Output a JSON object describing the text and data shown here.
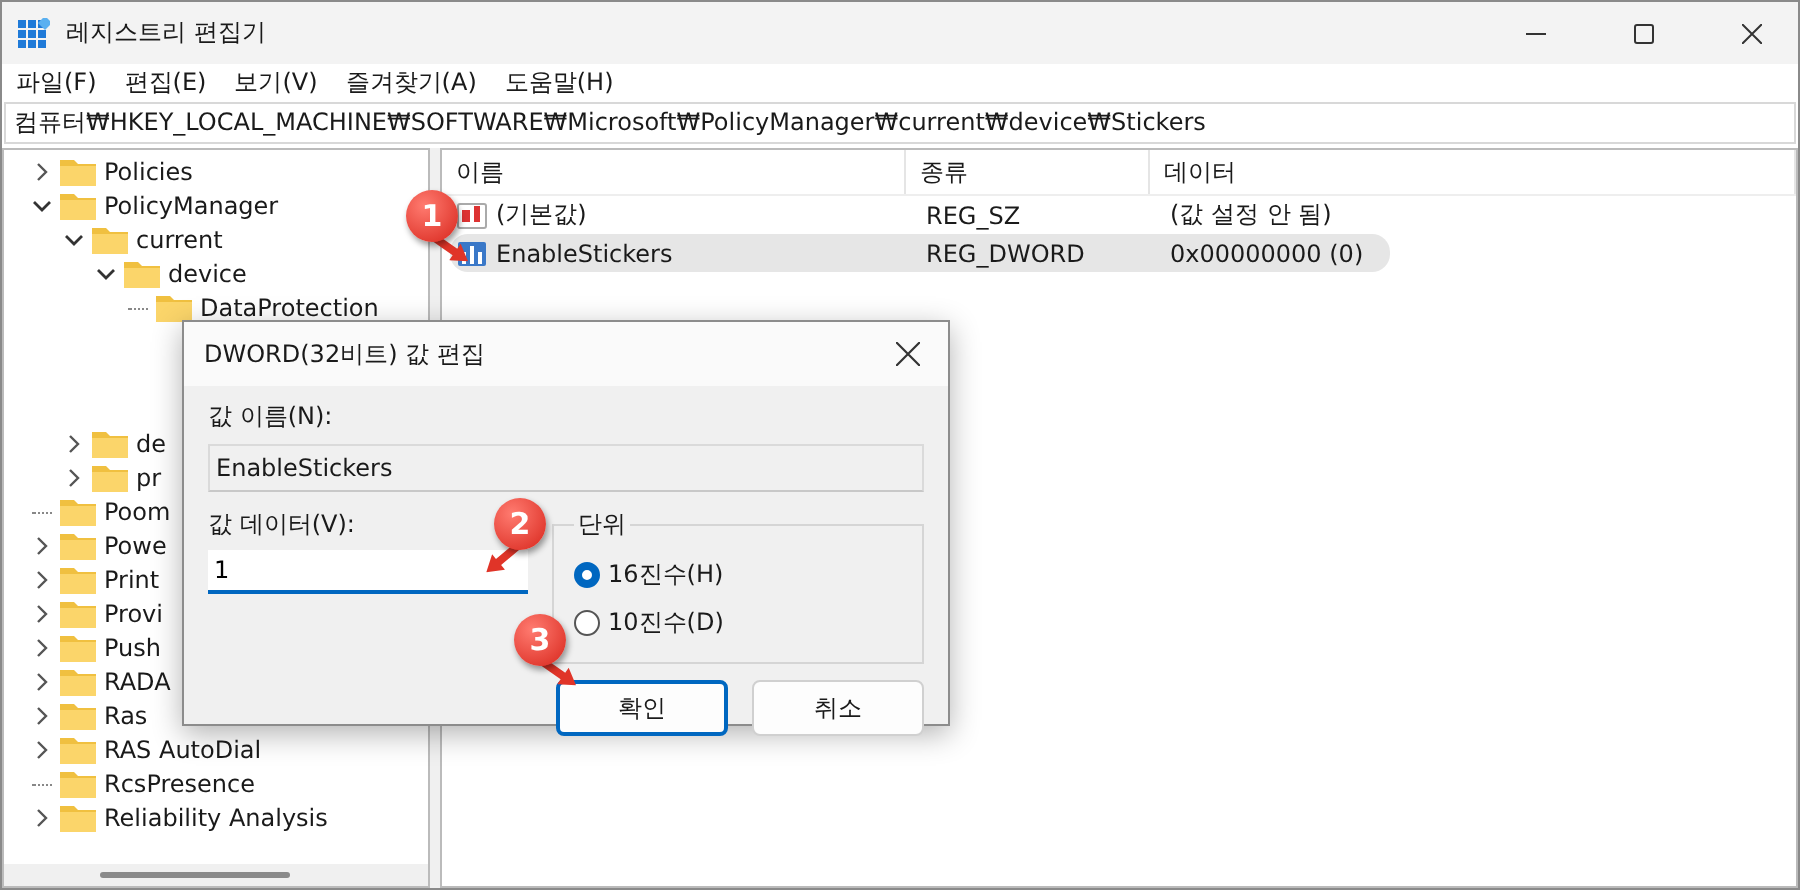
{
  "window": {
    "title": "레지스트리 편집기"
  },
  "menu": [
    {
      "label": "파일(F)"
    },
    {
      "label": "편집(E)"
    },
    {
      "label": "보기(V)"
    },
    {
      "label": "즐겨찾기(A)"
    },
    {
      "label": "도움말(H)"
    }
  ],
  "address": "컴퓨터₩HKEY_LOCAL_MACHINE₩SOFTWARE₩Microsoft₩PolicyManager₩current₩device₩Stickers",
  "tree": [
    {
      "name": "Policies",
      "kind": "branch",
      "expanded": false
    },
    {
      "name": "PolicyManager",
      "kind": "branch",
      "expanded": true,
      "children": [
        {
          "name": "current",
          "kind": "branch",
          "expanded": true,
          "children": [
            {
              "name": "device",
              "kind": "branch",
              "expanded": true,
              "children": [
                {
                  "name": "DataProtection",
                  "kind": "leaf"
                }
              ]
            }
          ]
        },
        {
          "name": "de",
          "kind": "branch",
          "expanded": false
        },
        {
          "name": "pr",
          "kind": "branch",
          "expanded": false
        }
      ]
    },
    {
      "name": "Poom",
      "kind": "leaf"
    },
    {
      "name": "Powe",
      "kind": "branch",
      "expanded": false
    },
    {
      "name": "Print",
      "kind": "branch",
      "expanded": false
    },
    {
      "name": "Provi",
      "kind": "branch",
      "expanded": false
    },
    {
      "name": "Push",
      "kind": "branch",
      "expanded": false
    },
    {
      "name": "RADA",
      "kind": "branch",
      "expanded": false
    },
    {
      "name": "Ras",
      "kind": "branch",
      "expanded": false
    },
    {
      "name": "RAS AutoDial",
      "kind": "branch",
      "expanded": false
    },
    {
      "name": "RcsPresence",
      "kind": "leaf"
    },
    {
      "name": "Reliability Analysis",
      "kind": "branch",
      "expanded": false
    }
  ],
  "table": {
    "columns": [
      "이름",
      "종류",
      "데이터"
    ],
    "rows": [
      {
        "kind": "string",
        "name": "(기본값)",
        "type": "REG_SZ",
        "data": "(값 설정 안 됨)",
        "selected": false
      },
      {
        "kind": "dword",
        "name": "EnableStickers",
        "type": "REG_DWORD",
        "data": "0x00000000 (0)",
        "selected": true
      }
    ]
  },
  "dialog": {
    "title": "DWORD(32비트) 값 편집",
    "name_label": "값 이름(N):",
    "name_value": "EnableStickers",
    "data_label": "값 데이터(V):",
    "data_value": "1",
    "units": {
      "title": "단위",
      "options": [
        {
          "label": "16진수(H)",
          "selected": true
        },
        {
          "label": "10진수(D)",
          "selected": false
        }
      ]
    },
    "buttons": [
      {
        "label": "확인",
        "default": true
      },
      {
        "label": "취소",
        "default": false
      }
    ]
  },
  "callouts": [
    {
      "label": "1"
    },
    {
      "label": "2"
    },
    {
      "label": "3"
    }
  ]
}
